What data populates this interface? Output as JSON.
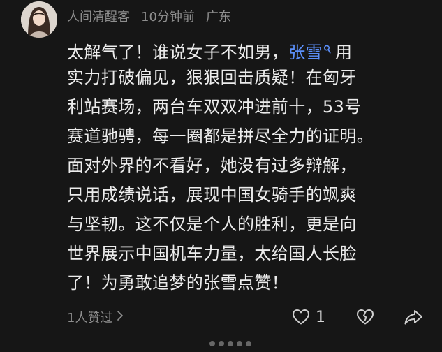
{
  "comment": {
    "author": "人间清醒客",
    "time": "10分钟前",
    "location": "广东",
    "mention": "张雪",
    "body_lines": [
      {
        "before": "太解气了！谁说女子不如男，",
        "after": "用"
      },
      {
        "text": "实力打破偏见，狠狠回击质疑！在匈牙"
      },
      {
        "text": "利站赛场，两台车双双冲进前十，53号"
      },
      {
        "text": "赛道驰骋，每一圈都是拼尽全力的证明。"
      },
      {
        "text": "面对外界的不看好，她没有过多辩解，"
      },
      {
        "text": "只用成绩说话，展现中国女骑手的飒爽"
      },
      {
        "text": "与坚韧。这不仅是个人的胜利，更是向"
      },
      {
        "text": "世界展示中国机车力量，太给国人长脸"
      },
      {
        "text": "了！为勇敢追梦的张雪点赞！"
      }
    ],
    "likers_text": "1人赞过",
    "like_count": "1"
  },
  "icons": {
    "avatar": "avatar-photo",
    "mention": "search-icon",
    "likers_chevron": "chevron-right-icon",
    "like": "heart-icon",
    "dislike": "broken-heart-icon",
    "share": "share-arrow-icon"
  },
  "colors": {
    "background": "#161616",
    "text": "#ececec",
    "meta": "#8e8e8e",
    "mention": "#5b8ff9"
  }
}
